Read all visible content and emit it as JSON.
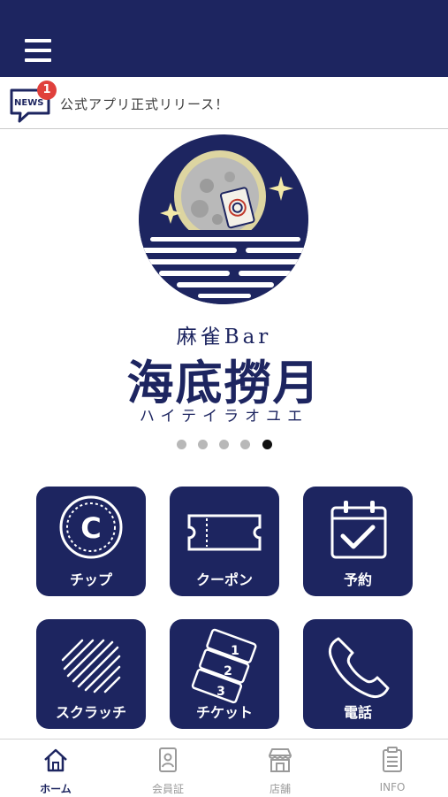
{
  "header": {
    "menu_icon": "hamburger-menu-icon",
    "color": "#1d2560"
  },
  "news": {
    "icon": "news-icon",
    "icon_label": "NEWS",
    "badge_count": "1",
    "text": "公式アプリ正式リリース！"
  },
  "brand": {
    "sub": "麻雀Bar",
    "title": "海底撈月",
    "kana": "ハイテイラオユエ"
  },
  "carousel": {
    "slide_count": 5,
    "active_index": 4
  },
  "tiles": [
    {
      "label": "チップ",
      "icon": "chip-coin-icon",
      "icon_letter": "C"
    },
    {
      "label": "クーポン",
      "icon": "coupon-ticket-icon"
    },
    {
      "label": "予約",
      "icon": "calendar-check-icon"
    },
    {
      "label": "スクラッチ",
      "icon": "scratch-icon"
    },
    {
      "label": "チケット",
      "icon": "ticket-stack-icon",
      "icon_numbers": [
        "1",
        "2",
        "3"
      ]
    },
    {
      "label": "電話",
      "icon": "phone-icon"
    }
  ],
  "tabbar": [
    {
      "label": "ホーム",
      "icon": "home-icon",
      "active": true
    },
    {
      "label": "会員証",
      "icon": "member-card-icon",
      "active": false
    },
    {
      "label": "店舗",
      "icon": "shop-icon",
      "active": false
    },
    {
      "label": "INFO",
      "icon": "info-document-icon",
      "active": false
    }
  ],
  "colors": {
    "primary": "#1d2560",
    "badge": "#e0403c",
    "moon": "#f3e9a8",
    "inactive": "#9a9a9a"
  }
}
